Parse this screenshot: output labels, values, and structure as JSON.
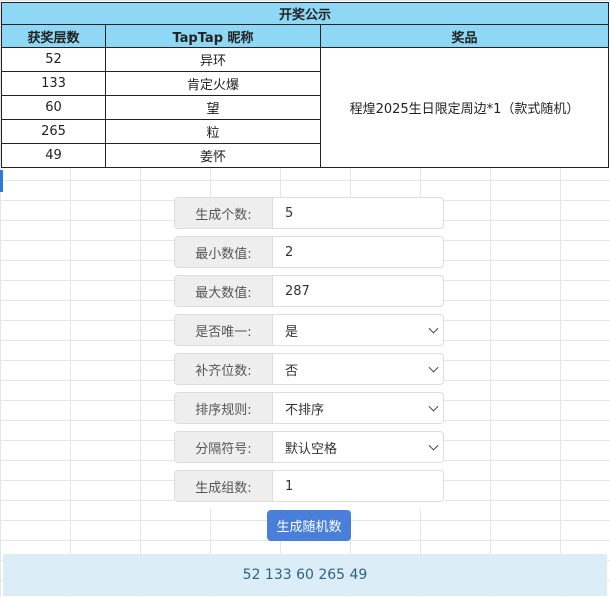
{
  "table": {
    "title": "开奖公示",
    "headers": [
      "获奖层数",
      "TapTap 昵称",
      "奖品"
    ],
    "rows": [
      {
        "floor": "52",
        "nickname": "异环"
      },
      {
        "floor": "133",
        "nickname": "肯定火爆"
      },
      {
        "floor": "60",
        "nickname": "望"
      },
      {
        "floor": "265",
        "nickname": "粒"
      },
      {
        "floor": "49",
        "nickname": "姜怀"
      }
    ],
    "prize": "程煌2025生日限定周边*1（款式随机）"
  },
  "form": {
    "fields": [
      {
        "label": "生成个数:",
        "value": "5",
        "type": "input"
      },
      {
        "label": "最小数值:",
        "value": "2",
        "type": "input"
      },
      {
        "label": "最大数值:",
        "value": "287",
        "type": "input"
      },
      {
        "label": "是否唯一:",
        "value": "是",
        "type": "select"
      },
      {
        "label": "补齐位数:",
        "value": "否",
        "type": "select"
      },
      {
        "label": "排序规则:",
        "value": "不排序",
        "type": "select"
      },
      {
        "label": "分隔符号:",
        "value": "默认空格",
        "type": "select"
      },
      {
        "label": "生成组数:",
        "value": "1",
        "type": "input"
      }
    ],
    "button_label": "生成随机数"
  },
  "result": "52 133 60 265 49",
  "colors": {
    "header_bg": "#8ed8f5",
    "button_bg": "#4a7fd9",
    "result_bg": "#dbeef7",
    "result_text": "#2c6383"
  }
}
